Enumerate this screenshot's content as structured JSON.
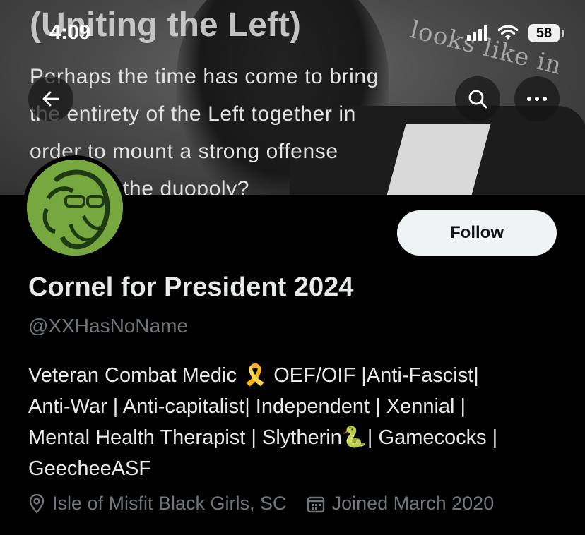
{
  "status_bar": {
    "time": "4:09",
    "battery": "58"
  },
  "banner": {
    "title": "(Uniting the Left)",
    "lines": [
      "Perhaps the time has come to bring",
      "the entirety of the Left together in",
      "order to mount a strong offense",
      "the duopoly?"
    ],
    "handwriting": "looks like in"
  },
  "nav": {
    "back_icon": "arrow-left-icon",
    "search_icon": "search-icon",
    "more_icon": "more-horizontal-icon"
  },
  "profile": {
    "display_name": "Cornel for President 2024",
    "handle": "@XXHasNoName",
    "follow_label": "Follow",
    "bio_lines": [
      "Veteran Combat Medic 🎗️ OEF/OIF |Anti-Fascist|",
      "Anti-War | Anti-capitalist| Independent | Xennial |",
      "Mental Health Therapist | Slytherin🐍| Gamecocks |",
      "GeecheeASF"
    ],
    "location": "Isle of Misfit Black Girls, SC",
    "joined": "Joined March 2020"
  },
  "colors": {
    "accent_avatar": "#76a83f",
    "muted_text": "#71767b",
    "background": "#000000"
  }
}
